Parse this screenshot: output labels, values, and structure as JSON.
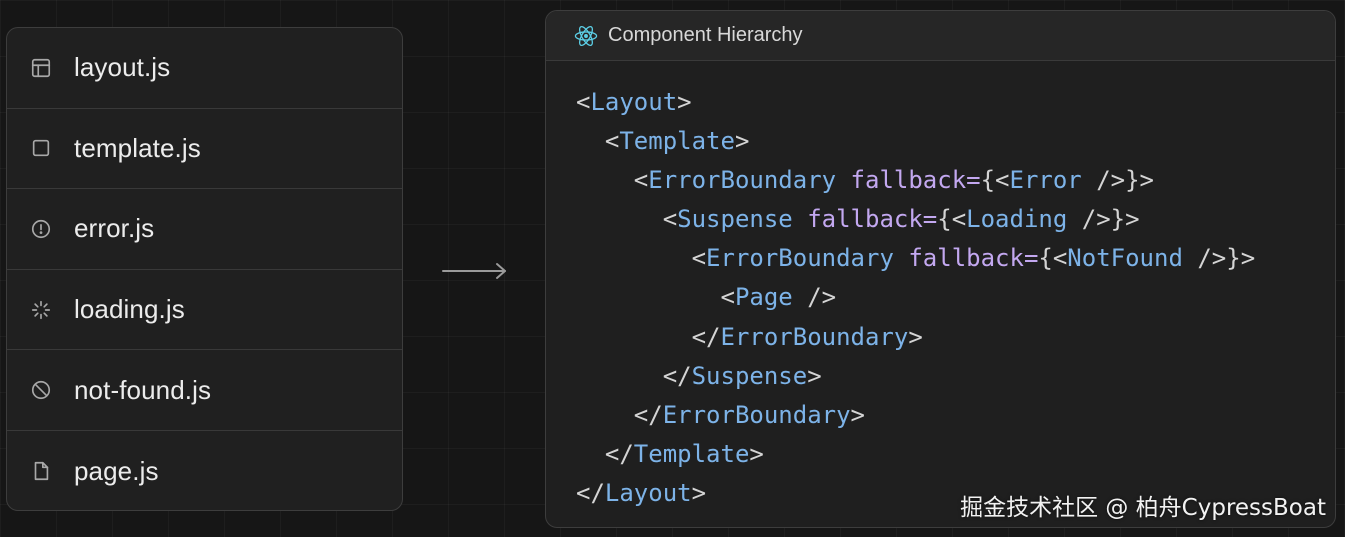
{
  "files": [
    {
      "icon": "layout-icon",
      "name": "layout.js"
    },
    {
      "icon": "template-icon",
      "name": "template.js"
    },
    {
      "icon": "alert-circle-icon",
      "name": "error.js"
    },
    {
      "icon": "spinner-icon",
      "name": "loading.js"
    },
    {
      "icon": "prohibited-icon",
      "name": "not-found.js"
    },
    {
      "icon": "file-icon",
      "name": "page.js"
    }
  ],
  "hierarchy": {
    "title": "Component Hierarchy",
    "icon": "react-icon",
    "code_lines": [
      [
        {
          "t": "<",
          "k": "punct"
        },
        {
          "t": "Layout",
          "k": "tag"
        },
        {
          "t": ">",
          "k": "punct"
        }
      ],
      [
        {
          "t": "  <",
          "k": "punct"
        },
        {
          "t": "Template",
          "k": "tag"
        },
        {
          "t": ">",
          "k": "punct"
        }
      ],
      [
        {
          "t": "    <",
          "k": "punct"
        },
        {
          "t": "ErrorBoundary",
          "k": "tag"
        },
        {
          "t": " ",
          "k": "punct"
        },
        {
          "t": "fallback=",
          "k": "attr"
        },
        {
          "t": "{<",
          "k": "punct"
        },
        {
          "t": "Error",
          "k": "tag"
        },
        {
          "t": " />}>",
          "k": "punct"
        }
      ],
      [
        {
          "t": "      <",
          "k": "punct"
        },
        {
          "t": "Suspense",
          "k": "tag"
        },
        {
          "t": " ",
          "k": "punct"
        },
        {
          "t": "fallback=",
          "k": "attr"
        },
        {
          "t": "{<",
          "k": "punct"
        },
        {
          "t": "Loading",
          "k": "tag"
        },
        {
          "t": " />}>",
          "k": "punct"
        }
      ],
      [
        {
          "t": "        <",
          "k": "punct"
        },
        {
          "t": "ErrorBoundary",
          "k": "tag"
        },
        {
          "t": " ",
          "k": "punct"
        },
        {
          "t": "fallback=",
          "k": "attr"
        },
        {
          "t": "{<",
          "k": "punct"
        },
        {
          "t": "NotFound",
          "k": "tag"
        },
        {
          "t": " />}>",
          "k": "punct"
        }
      ],
      [
        {
          "t": "          <",
          "k": "punct"
        },
        {
          "t": "Page",
          "k": "tag"
        },
        {
          "t": " />",
          "k": "punct"
        }
      ],
      [
        {
          "t": "        </",
          "k": "punct"
        },
        {
          "t": "ErrorBoundary",
          "k": "tag"
        },
        {
          "t": ">",
          "k": "punct"
        }
      ],
      [
        {
          "t": "      </",
          "k": "punct"
        },
        {
          "t": "Suspense",
          "k": "tag"
        },
        {
          "t": ">",
          "k": "punct"
        }
      ],
      [
        {
          "t": "    </",
          "k": "punct"
        },
        {
          "t": "ErrorBoundary",
          "k": "tag"
        },
        {
          "t": ">",
          "k": "punct"
        }
      ],
      [
        {
          "t": "  </",
          "k": "punct"
        },
        {
          "t": "Template",
          "k": "tag"
        },
        {
          "t": ">",
          "k": "punct"
        }
      ],
      [
        {
          "t": "</",
          "k": "punct"
        },
        {
          "t": "Layout",
          "k": "tag"
        },
        {
          "t": ">",
          "k": "punct"
        }
      ]
    ]
  },
  "watermark": "掘金技术社区 @ 柏舟CypressBoat",
  "colors": {
    "tag": "#7db3e8",
    "attr": "#c3a8f0",
    "punct": "#d4d4d4",
    "react": "#5ccfe6"
  }
}
